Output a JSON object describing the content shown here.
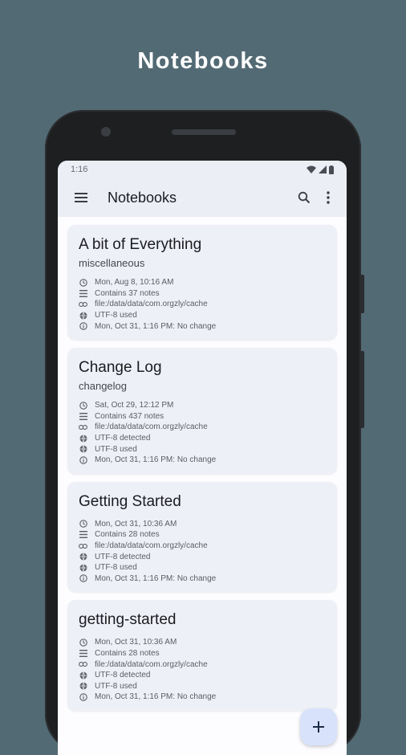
{
  "headline": "Notebooks",
  "status": {
    "time": "1:16"
  },
  "appbar": {
    "title": "Notebooks"
  },
  "notebooks": [
    {
      "title": "A bit of Everything",
      "subtitle": "miscellaneous",
      "meta": [
        {
          "icon": "clock-icon",
          "text": "Mon, Aug 8, 10:16 AM"
        },
        {
          "icon": "list-icon",
          "text": "Contains 37 notes"
        },
        {
          "icon": "link-icon",
          "text": "file:/data/data/com.orgzly/cache"
        },
        {
          "icon": "globe-icon",
          "text": "UTF-8 used"
        },
        {
          "icon": "info-icon",
          "text": "Mon, Oct 31, 1:16 PM: No change"
        }
      ]
    },
    {
      "title": "Change Log",
      "subtitle": "changelog",
      "meta": [
        {
          "icon": "clock-icon",
          "text": "Sat, Oct 29, 12:12 PM"
        },
        {
          "icon": "list-icon",
          "text": "Contains 437 notes"
        },
        {
          "icon": "link-icon",
          "text": "file:/data/data/com.orgzly/cache"
        },
        {
          "icon": "globe-icon",
          "text": "UTF-8 detected"
        },
        {
          "icon": "globe-icon",
          "text": "UTF-8 used"
        },
        {
          "icon": "info-icon",
          "text": "Mon, Oct 31, 1:16 PM: No change"
        }
      ]
    },
    {
      "title": "Getting Started",
      "subtitle": "",
      "meta": [
        {
          "icon": "clock-icon",
          "text": "Mon, Oct 31, 10:36 AM"
        },
        {
          "icon": "list-icon",
          "text": "Contains 28 notes"
        },
        {
          "icon": "link-icon",
          "text": "file:/data/data/com.orgzly/cache"
        },
        {
          "icon": "globe-icon",
          "text": "UTF-8 detected"
        },
        {
          "icon": "globe-icon",
          "text": "UTF-8 used"
        },
        {
          "icon": "info-icon",
          "text": "Mon, Oct 31, 1:16 PM: No change"
        }
      ]
    },
    {
      "title": "getting-started",
      "subtitle": "",
      "meta": [
        {
          "icon": "clock-icon",
          "text": "Mon, Oct 31, 10:36 AM"
        },
        {
          "icon": "list-icon",
          "text": "Contains 28 notes"
        },
        {
          "icon": "link-icon",
          "text": "file:/data/data/com.orgzly/cache"
        },
        {
          "icon": "globe-icon",
          "text": "UTF-8 detected"
        },
        {
          "icon": "globe-icon",
          "text": "UTF-8 used"
        },
        {
          "icon": "info-icon",
          "text": "Mon, Oct 31, 1:16 PM: No change"
        }
      ]
    }
  ]
}
